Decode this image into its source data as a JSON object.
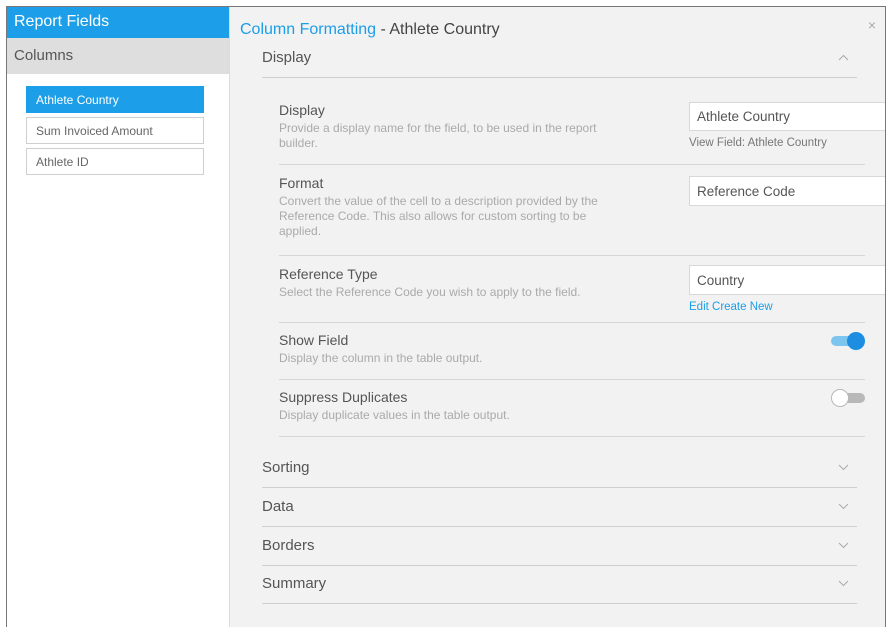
{
  "left_panel": {
    "header": "Report Fields",
    "subheader": "Columns",
    "columns": [
      {
        "label": "Athlete Country",
        "active": true
      },
      {
        "label": "Sum Invoiced Amount",
        "active": false
      },
      {
        "label": "Athlete ID",
        "active": false
      }
    ]
  },
  "right_panel": {
    "title_accent": "Column Formatting",
    "title_rest": " - Athlete Country",
    "close_glyph": "×",
    "display_section": {
      "label": "Display",
      "fields": {
        "display": {
          "title": "Display",
          "description": "Provide a display name for the field, to be used in the report builder.",
          "value": "Athlete Country",
          "view_field": "View Field: Athlete Country"
        },
        "format": {
          "title": "Format",
          "description": "Convert the value of the cell to a description provided by the Reference Code. This also allows for custom sorting to be applied.",
          "selected": "Reference Code"
        },
        "reference_type": {
          "title": "Reference Type",
          "description": "Select the Reference Code you wish to apply to the field.",
          "selected": "Country",
          "links": "Edit Create New"
        },
        "show_field": {
          "title": "Show Field",
          "description": "Display the column in the table output.",
          "enabled": true
        },
        "suppress_duplicates": {
          "title": "Suppress Duplicates",
          "description": "Display duplicate values in the table output.",
          "enabled": false
        }
      }
    },
    "collapsed_sections": [
      "Sorting",
      "Data",
      "Borders",
      "Summary"
    ]
  },
  "colors": {
    "accent": "#1c9ee8",
    "panel_bg": "#f2f2f2"
  },
  "icons": {
    "close": "close-icon",
    "chevron_up": "chevron-up-icon",
    "chevron_down": "chevron-down-icon"
  }
}
